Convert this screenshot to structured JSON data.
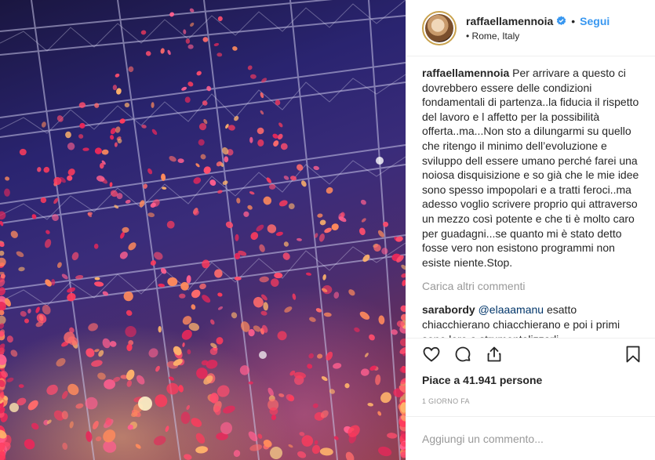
{
  "author": {
    "username": "raffaellamennoia",
    "follow_label": "Segui",
    "location": "Rome, Italy",
    "verified_icon": "verified-badge-icon",
    "verified_color": "#3897f0"
  },
  "caption": {
    "username": "raffaellamennoia",
    "text": "Per arrivare a questo ci dovrebbero essere delle condizioni fondamentali di partenza..la fiducia il rispetto del lavoro e l affetto per la possibilità offerta..ma...Non sto a dilungarmi su quello che ritengo il minimo dell’evoluzione e sviluppo dell essere umano perché farei una noiosa disquisizione e so già che le mie idee sono spesso impopolari e a tratti feroci..ma adesso voglio scrivere proprio qui attraverso un mezzo così potente e che ti è molto caro per guadagni...se quanto mi è stato detto fosse vero non esistono programmi non esiste niente.Stop."
  },
  "load_more_label": "Carica altri commenti",
  "comments": [
    {
      "username": "sarabordy",
      "mention": "@elaaamanu",
      "text": " esatto chiacchierano chiacchierano e poi i primi sono loro a strumentalizzarli"
    }
  ],
  "actions": {
    "like_icon": "heart-icon",
    "comment_icon": "comment-icon",
    "share_icon": "share-icon",
    "save_icon": "bookmark-icon"
  },
  "likes_text": "Piace a 41.941 persone",
  "timestamp": "1 GIORNO FA",
  "add_comment_placeholder": "Aggiungi un commento..."
}
